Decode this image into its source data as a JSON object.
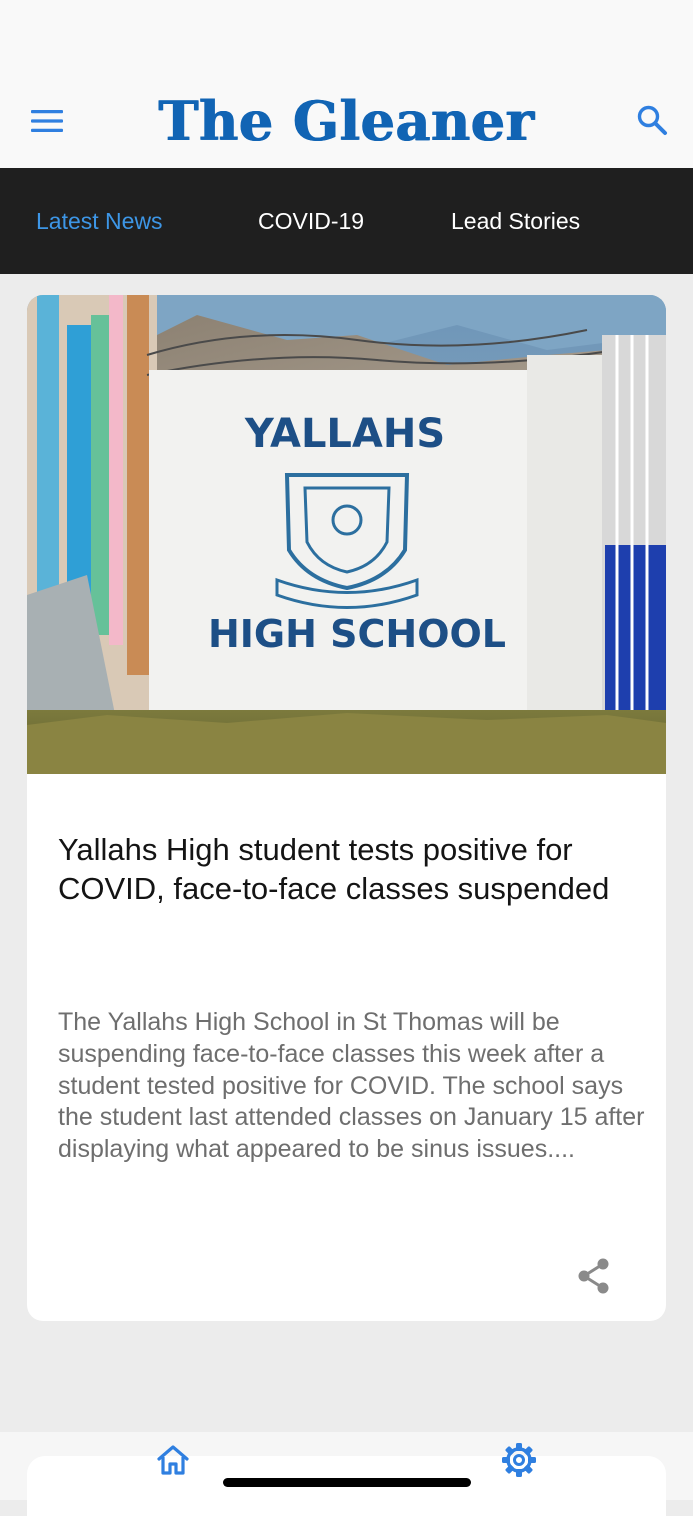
{
  "header": {
    "brand": "The Gleaner",
    "menu_icon": "hamburger-menu-icon",
    "search_icon": "search-icon"
  },
  "tabs": [
    {
      "label": "Latest News",
      "active": true
    },
    {
      "label": "COVID-19",
      "active": false
    },
    {
      "label": "Lead Stories",
      "active": false
    }
  ],
  "article": {
    "image_sign_line1": "YALLAHS",
    "image_sign_line2": "HIGH SCHOOL",
    "title": "Yallahs High student tests positive for COVID, face-to-face classes suspended",
    "summary": "The Yallahs High School in St Thomas will be suspending face-to-face classes this week after a student tested positive for COVID. The school says the student last attended classes on January 15 after displaying what appeared to be sinus issues....",
    "share_icon": "share-icon"
  },
  "bottom_nav": {
    "home_icon": "home-icon",
    "settings_icon": "gear-icon"
  },
  "colors": {
    "brand_blue": "#1164b4",
    "active_tab": "#3d96e6",
    "tab_bar": "#1f1f1f",
    "nav_icon": "#2f7fe0",
    "page_bg": "#ececec"
  }
}
